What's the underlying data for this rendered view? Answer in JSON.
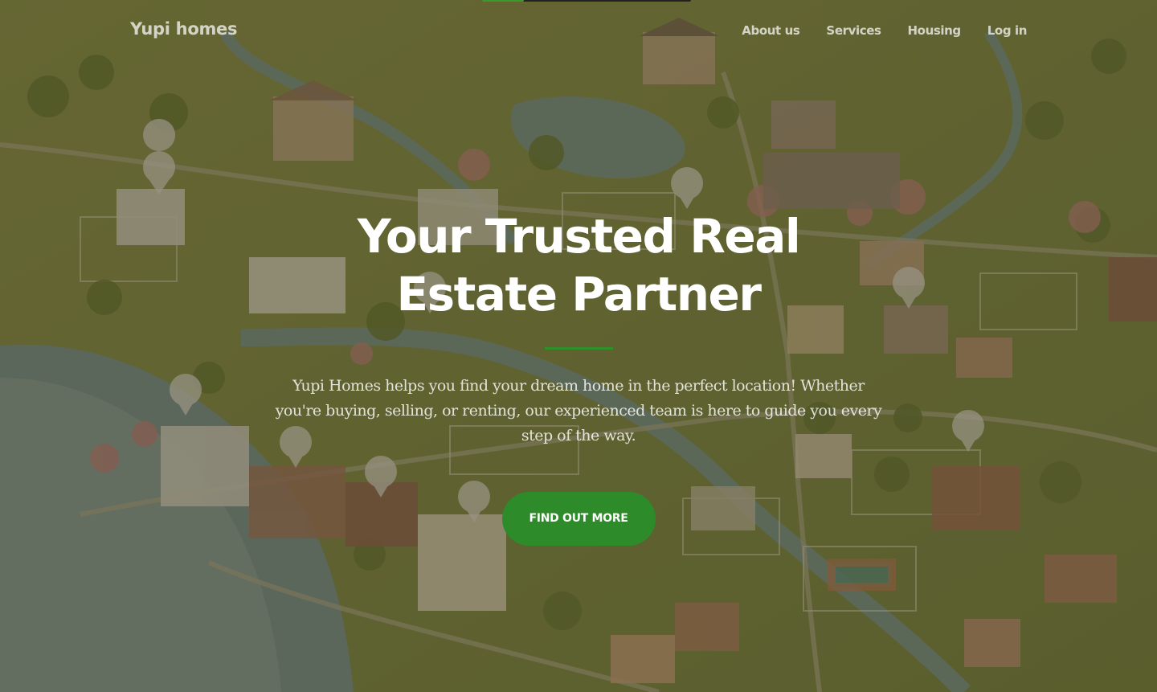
{
  "navbar": {
    "brand": "Yupi homes",
    "links": [
      {
        "label": "About us"
      },
      {
        "label": "Services"
      },
      {
        "label": "Housing"
      },
      {
        "label": "Log in"
      }
    ]
  },
  "hero": {
    "headline": "Your Trusted Real Estate Partner",
    "lead": "Yupi Homes helps you find your dream home in the perfect location! Whether you're buying, selling, or renting, our experienced team is here to guide you every step of the way.",
    "cta_label": "FIND OUT MORE"
  },
  "colors": {
    "accent": "#2d8b2a",
    "overlay": "rgba(70,60,30,0.45)"
  }
}
